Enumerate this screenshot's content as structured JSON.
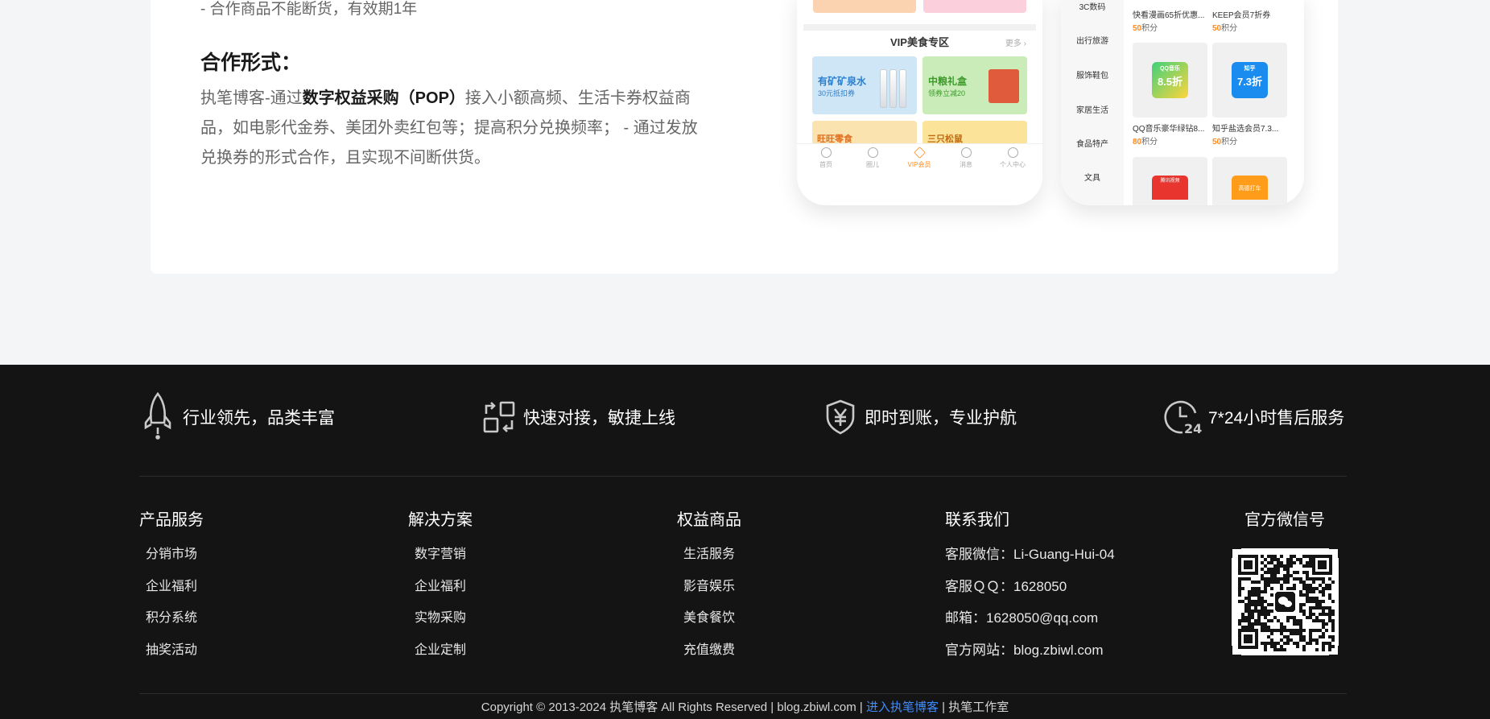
{
  "content": {
    "previous_line": "- 合作商品不能断货，有效期1年",
    "section_title": "合作形式：",
    "body_prefix": "执笔博客-通过",
    "body_bold": "数字权益采购（POP）",
    "body_suffix": "接入小额高频、生活卡券权益商品，如电影代金券、美团外卖红包等；提高积分兑换频率； - 通过发放兑换券的形式合作，且实现不间断供货。"
  },
  "phone_vip": {
    "title": "VIP美食专区",
    "more": "更多",
    "promos": [
      {
        "title": "有矿矿泉水",
        "subtitle": "30元抵扣券"
      },
      {
        "title": "中粮礼盒",
        "subtitle": "领券立减20"
      }
    ],
    "partial_promos": [
      "旺旺零食",
      "三只松鼠"
    ],
    "tabs": [
      "首页",
      "圈儿",
      "VIP会员",
      "消息",
      "个人中心"
    ],
    "accent": "#ff8a1f"
  },
  "phone_mall": {
    "categories": [
      "3C数码",
      "出行旅游",
      "服饰鞋包",
      "家居生活",
      "食品特产",
      "文具"
    ],
    "goods": [
      {
        "name": "快看漫画65折优惠...",
        "points": "50",
        "unit": "积分"
      },
      {
        "name": "KEEP会员7折券",
        "points": "50",
        "unit": "积分"
      },
      {
        "name": "QQ音乐豪华绿钻8...",
        "points": "80",
        "unit": "积分",
        "badge": "8.5折",
        "badge_label": "QQ音乐"
      },
      {
        "name": "知乎盐选会员7.3...",
        "points": "50",
        "unit": "积分",
        "badge": "7.3折",
        "badge_label": "知乎"
      }
    ],
    "partial_goods": [
      "腾讯视频",
      "高德打车"
    ]
  },
  "footer": {
    "features": [
      {
        "icon": "rocket-icon",
        "text": "行业领先，品类丰富"
      },
      {
        "icon": "sync-icon",
        "text": "快速对接，敏捷上线"
      },
      {
        "icon": "yuan-shield-icon",
        "text": "即时到账，专业护航"
      },
      {
        "icon": "clock-24-icon",
        "text": "7*24小时售后服务"
      }
    ],
    "columns": [
      {
        "title": "产品服务",
        "links": [
          "分销市场",
          "企业福利",
          "积分系统",
          "抽奖活动"
        ]
      },
      {
        "title": "解决方案",
        "links": [
          "数字营销",
          "企业福利",
          "实物采购",
          "企业定制"
        ]
      },
      {
        "title": "权益商品",
        "links": [
          "生活服务",
          "影音娱乐",
          "美食餐饮",
          "充值缴费"
        ]
      }
    ],
    "contact": {
      "title": "联系我们",
      "lines": [
        "客服微信：Li-Guang-Hui-04",
        "客服ＱＱ：1628050",
        "邮箱：1628050@qq.com",
        "官方网站：blog.zbiwl.com"
      ]
    },
    "wechat": {
      "title": "官方微信号"
    },
    "copyright": {
      "text": "Copyright © 2013-2024 执笔博客 All Rights Reserved | blog.zbiwl.com | ",
      "link": "进入执笔博客",
      "suffix": " | 执笔工作室",
      "link_color": "#3f8cff"
    }
  }
}
